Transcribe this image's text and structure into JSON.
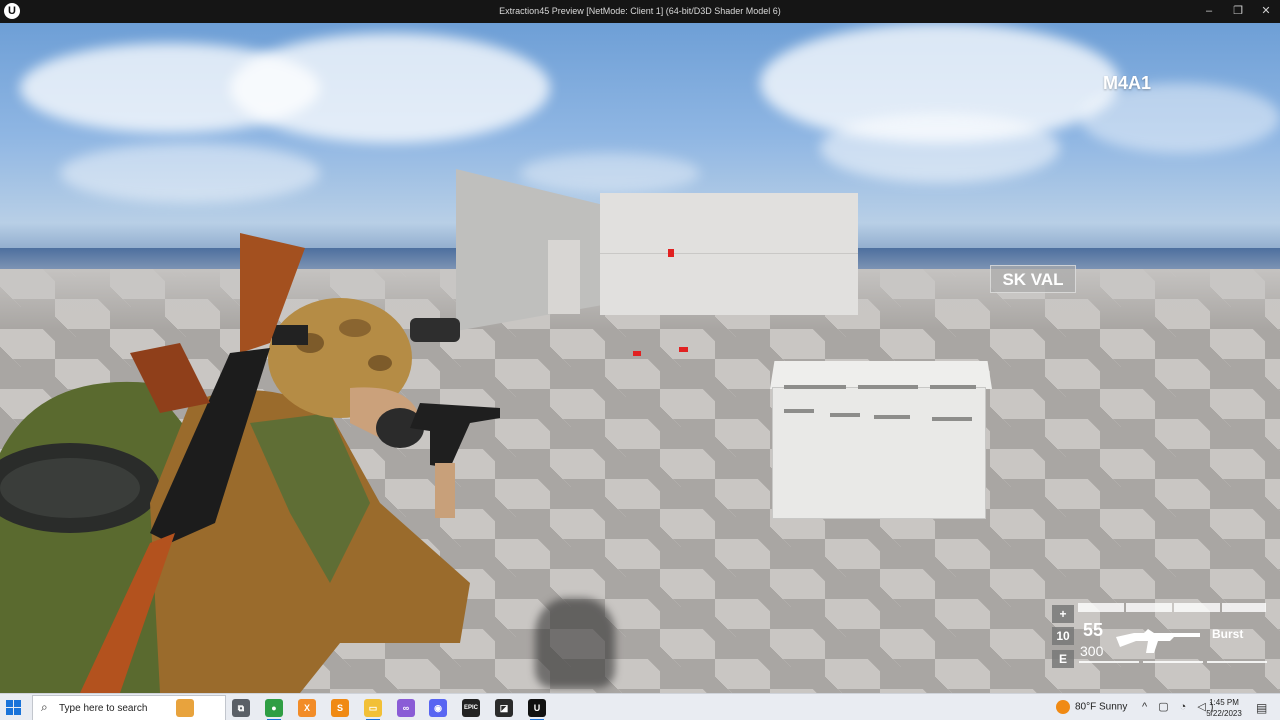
{
  "window": {
    "title": "Extraction45 Preview [NetMode: Client 1]  (64-bit/D3D Shader Model 6)",
    "logo_glyph": "U",
    "minimize": "–",
    "restore": "❐",
    "close": "✕"
  },
  "hud": {
    "weapon_name": "M4A1",
    "pickup_label": "SK VAL",
    "keys": [
      "+",
      "10",
      "E"
    ],
    "magazine": "55",
    "reserve": "300",
    "fire_mode": "Burst"
  },
  "taskbar": {
    "search_placeholder": "Type here to search",
    "search_icon": "⌕",
    "apps": [
      {
        "name": "explorer-notes-icon",
        "glyph": "",
        "color": "#e8a33d"
      },
      {
        "name": "task-view-icon",
        "glyph": "⧉",
        "color": "#5a5f66"
      },
      {
        "name": "chrome-icon",
        "glyph": "●",
        "color": "#2f9e44"
      },
      {
        "name": "xampp-icon",
        "glyph": "X",
        "color": "#f28c28"
      },
      {
        "name": "sublime-icon",
        "glyph": "S",
        "color": "#f08a14"
      },
      {
        "name": "file-explorer-icon",
        "glyph": "▭",
        "color": "#f2c037"
      },
      {
        "name": "visual-studio-icon",
        "glyph": "∞",
        "color": "#8a5cd6"
      },
      {
        "name": "discord-icon",
        "glyph": "◉",
        "color": "#5865f2"
      },
      {
        "name": "epic-games-icon",
        "glyph": "EPIC",
        "color": "#222222"
      },
      {
        "name": "photo-app-icon",
        "glyph": "◪",
        "color": "#2b2b2b"
      },
      {
        "name": "unreal-engine-icon",
        "glyph": "U",
        "color": "#111111"
      }
    ],
    "weather": "80°F  Sunny",
    "tray": "^ ▢ ◔ ◁)",
    "time": "1:45 PM",
    "date": "5/22/2023",
    "notifications_icon": "▤"
  },
  "colors": {
    "sky": "#8fb6e3",
    "floor_light": "#c9c6c3",
    "floor_dark": "#a9a6a3",
    "marker": "#e12121",
    "accent": "#1a73d9"
  }
}
